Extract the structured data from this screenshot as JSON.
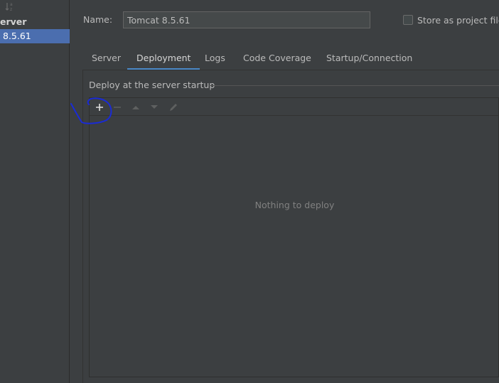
{
  "left_panel": {
    "group_label": "erver",
    "selected_item": "8.5.61"
  },
  "config": {
    "name_label": "Name:",
    "name_value": "Tomcat 8.5.61",
    "store_label": "Store as project file"
  },
  "tabs": [
    {
      "label": "Server"
    },
    {
      "label": "Deployment"
    },
    {
      "label": "Logs"
    },
    {
      "label": "Code Coverage"
    },
    {
      "label": "Startup/Connection"
    }
  ],
  "deploy": {
    "group_title": "Deploy at the server startup",
    "empty_text": "Nothing to deploy",
    "toolbar": {
      "add_icon": "plus-icon",
      "remove_icon": "minus-icon",
      "up_icon": "arrow-up-icon",
      "down_icon": "arrow-down-icon",
      "edit_icon": "pencil-icon"
    }
  },
  "colors": {
    "background": "#3c3f41",
    "selection": "#4b6eaf",
    "tab_accent": "#4a88c7",
    "annotation": "#1a2bd6"
  }
}
